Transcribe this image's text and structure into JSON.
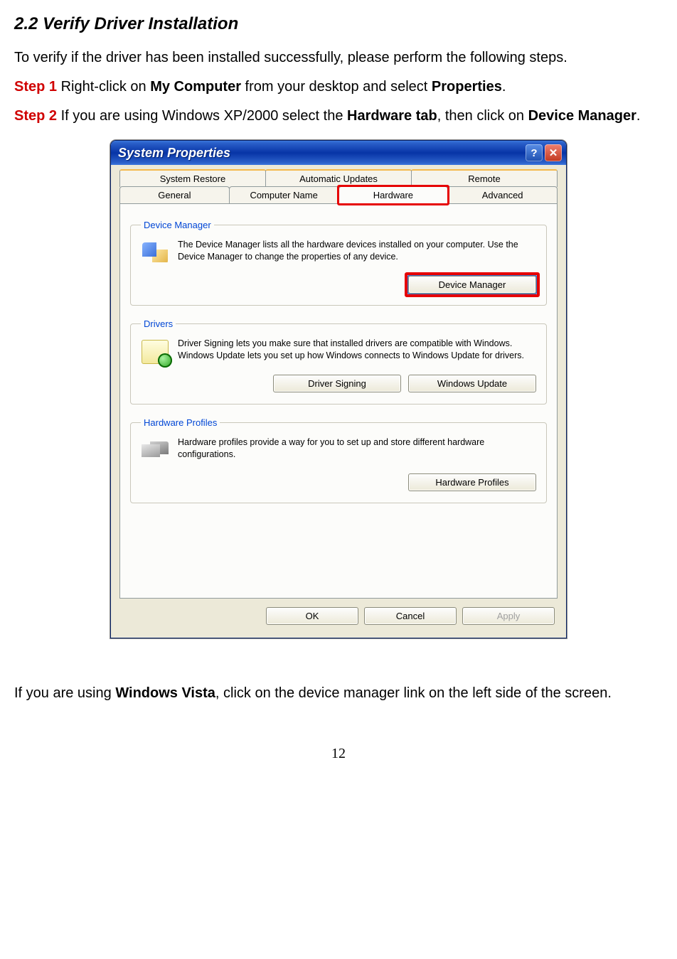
{
  "section_title": "2.2 Verify Driver Installation",
  "intro_text": "To verify if the driver has been installed successfully, please perform the following steps.",
  "step1": {
    "label": "Step 1",
    "pre": " Right-click on ",
    "bold1": "My Computer",
    "mid": " from your desktop and select ",
    "bold2": "Properties",
    "post": "."
  },
  "step2": {
    "label": "Step 2",
    "pre": " If you are using Windows XP/2000 select the ",
    "bold1": "Hardware tab",
    "mid": ", then click on ",
    "bold2": "Device Manager",
    "post": "."
  },
  "vista": {
    "pre": "If you are using ",
    "bold": "Windows Vista",
    "post": ", click on the device manager link on the left side of the screen."
  },
  "dialog": {
    "title": "System Properties",
    "help_icon": "?",
    "close_icon": "✕",
    "tabs_row1": [
      "System Restore",
      "Automatic Updates",
      "Remote"
    ],
    "tabs_row2": [
      "General",
      "Computer Name",
      "Hardware",
      "Advanced"
    ],
    "active_tab": "Hardware",
    "groups": {
      "devmgr": {
        "legend": "Device Manager",
        "text": "The Device Manager lists all the hardware devices installed on your computer. Use the Device Manager to change the properties of any device.",
        "button": "Device Manager"
      },
      "drivers": {
        "legend": "Drivers",
        "text": "Driver Signing lets you make sure that installed drivers are compatible with Windows. Windows Update lets you set up how Windows connects to Windows Update for drivers.",
        "button1": "Driver Signing",
        "button2": "Windows Update"
      },
      "hwprof": {
        "legend": "Hardware Profiles",
        "text": "Hardware profiles provide a way for you to set up and store different hardware configurations.",
        "button": "Hardware Profiles"
      }
    },
    "footer": {
      "ok": "OK",
      "cancel": "Cancel",
      "apply": "Apply"
    }
  },
  "page_number": "12"
}
